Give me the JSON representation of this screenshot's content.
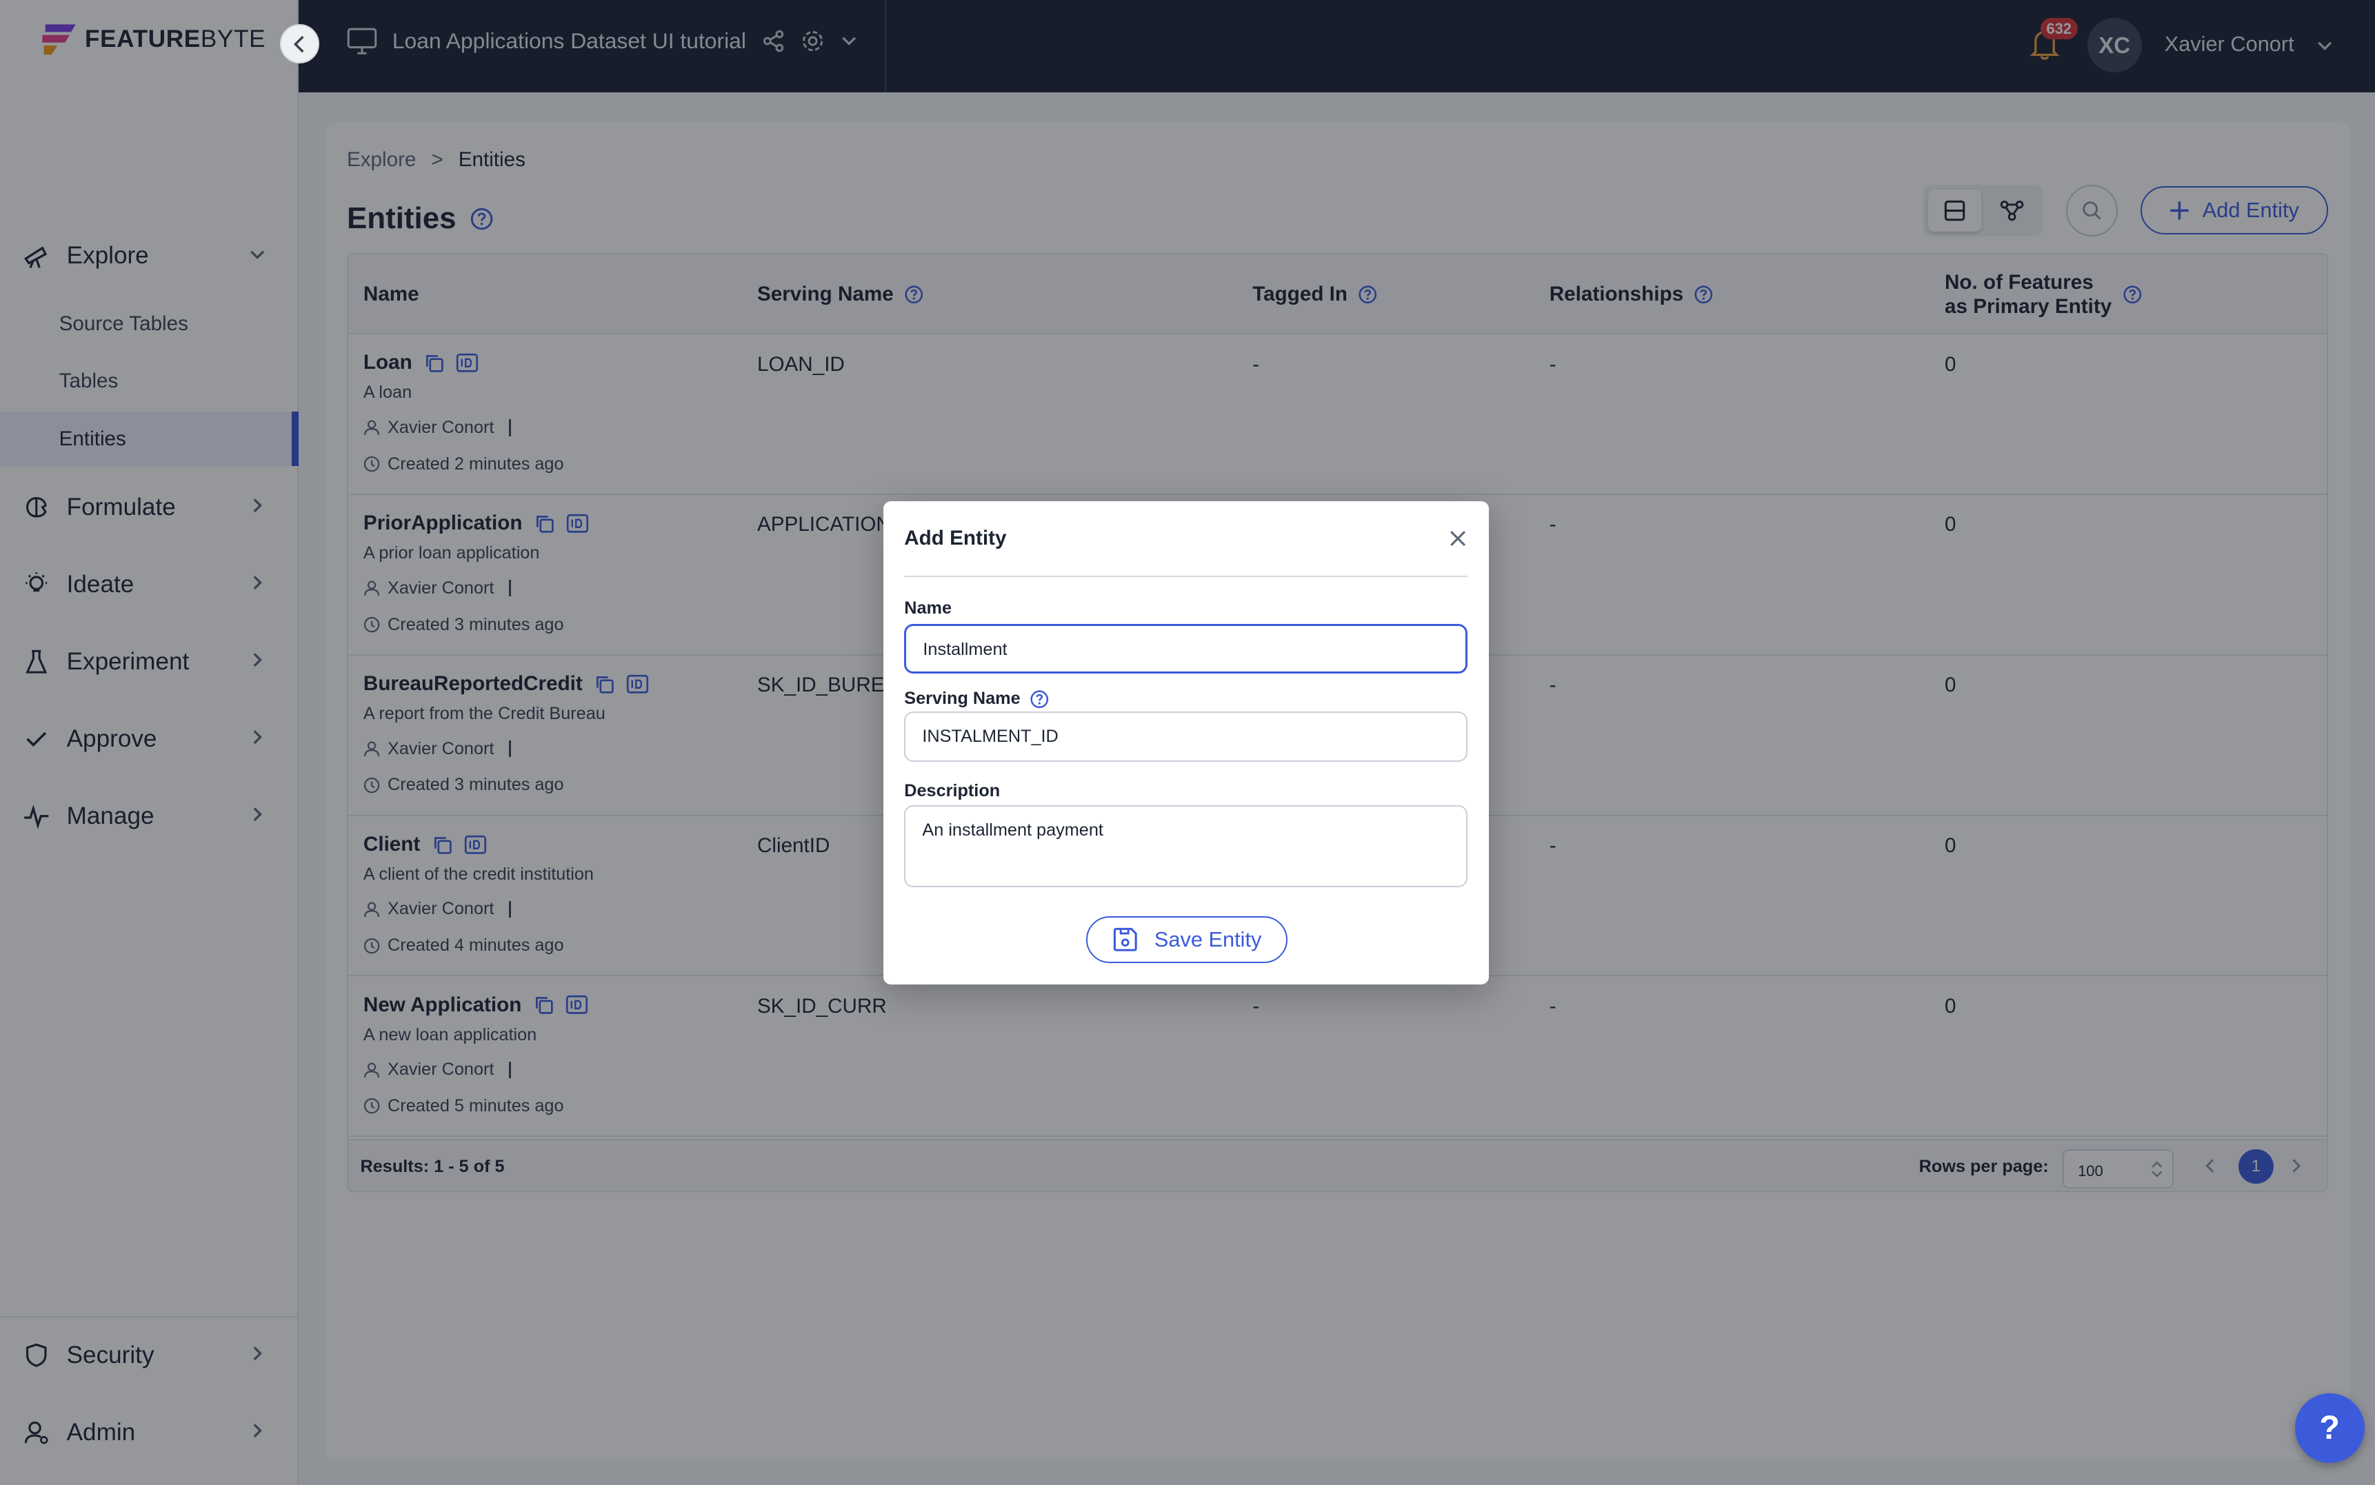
{
  "app": {
    "logo_text_bold": "FEATURE",
    "logo_text_light": "BYTE"
  },
  "topbar": {
    "project": "Loan Applications Dataset UI tutorial",
    "notifications": "632",
    "avatar_initials": "XC",
    "user_name": "Xavier Conort"
  },
  "sidebar": {
    "explore": "Explore",
    "explore_sub": [
      "Source Tables",
      "Tables",
      "Entities"
    ],
    "formulate": "Formulate",
    "ideate": "Ideate",
    "experiment": "Experiment",
    "approve": "Approve",
    "manage": "Manage",
    "security": "Security",
    "admin": "Admin"
  },
  "breadcrumb": {
    "root": "Explore",
    "sep": ">",
    "current": "Entities"
  },
  "page": {
    "title": "Entities",
    "add_button": "Add Entity"
  },
  "table": {
    "headers": {
      "name": "Name",
      "serving": "Serving Name",
      "tagged": "Tagged In",
      "relationships": "Relationships",
      "features_l1": "No. of Features",
      "features_l2": "as Primary Entity"
    },
    "rows": [
      {
        "name": "Loan",
        "desc": "A loan",
        "owner": "Xavier Conort",
        "created": "Created 2 minutes ago",
        "serving": "LOAN_ID",
        "tagged": "-",
        "relationships": "-",
        "features": "0"
      },
      {
        "name": "PriorApplication",
        "desc": "A prior loan application",
        "owner": "Xavier Conort",
        "created": "Created 3 minutes ago",
        "serving": "APPLICATION",
        "tagged": "-",
        "relationships": "-",
        "features": "0"
      },
      {
        "name": "BureauReportedCredit",
        "desc": "A report from the Credit Bureau",
        "owner": "Xavier Conort",
        "created": "Created 3 minutes ago",
        "serving": "SK_ID_BUREA",
        "tagged": "-",
        "relationships": "-",
        "features": "0"
      },
      {
        "name": "Client",
        "desc": "A client of the credit institution",
        "owner": "Xavier Conort",
        "created": "Created 4 minutes ago",
        "serving": "ClientID",
        "tagged": "-",
        "relationships": "-",
        "features": "0"
      },
      {
        "name": "New Application",
        "desc": "A new loan application",
        "owner": "Xavier Conort",
        "created": "Created 5 minutes ago",
        "serving": "SK_ID_CURR",
        "tagged": "-",
        "relationships": "-",
        "features": "0"
      }
    ],
    "results": "Results: 1 - 5 of 5",
    "rows_per_page_label": "Rows per page:",
    "rows_per_page": "100",
    "page": "1"
  },
  "modal": {
    "title": "Add Entity",
    "name_label": "Name",
    "name_value": "Installment",
    "serving_label": "Serving Name",
    "serving_value": "INSTALMENT_ID",
    "desc_label": "Description",
    "desc_value": "An installment payment",
    "save_label": "Save Entity"
  },
  "help_fab": "?",
  "colors": {
    "accent": "#3b5bdb",
    "topbar": "#1b2234",
    "badge": "#d6343a"
  }
}
